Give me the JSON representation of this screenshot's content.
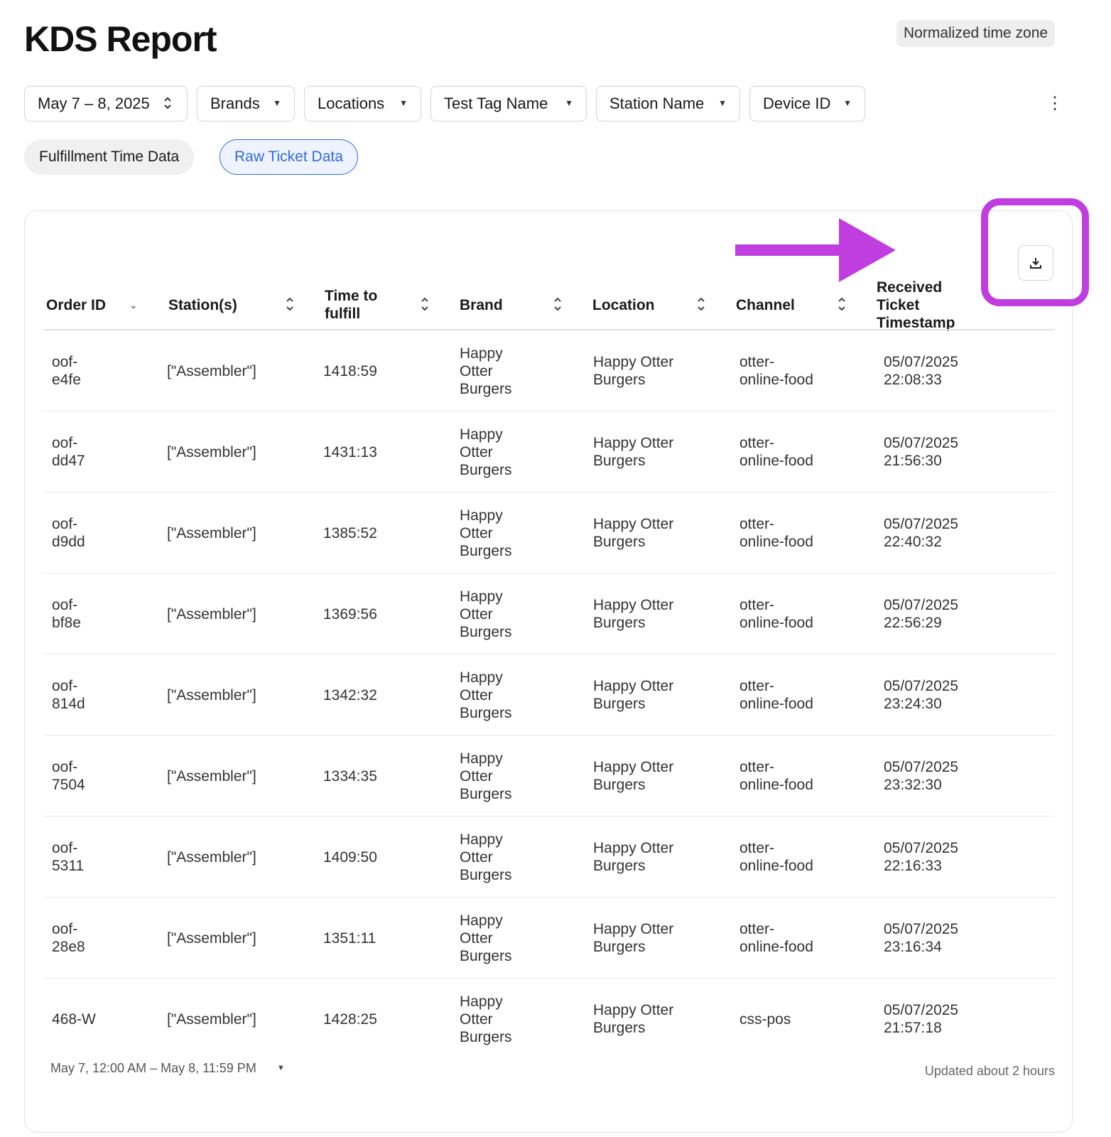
{
  "header": {
    "title": "KDS Report",
    "timezone_badge": "Normalized time zone"
  },
  "filters": {
    "date_range": "May 7 – 8, 2025",
    "brands": "Brands",
    "locations": "Locations",
    "test_tag": "Test Tag Name",
    "station": "Station Name",
    "device": "Device ID"
  },
  "tabs": {
    "fulfillment": "Fulfillment Time Data",
    "raw": "Raw Ticket Data"
  },
  "table": {
    "columns": {
      "order_id": "Order ID",
      "stations": "Station(s)",
      "time_to_fulfill_1": "Time to",
      "time_to_fulfill_2": "fulfill",
      "brand": "Brand",
      "location": "Location",
      "channel": "Channel",
      "received_1": "Received",
      "received_2": "Ticket",
      "received_3": "Timestamp"
    },
    "rows": [
      {
        "order_a": "oof-",
        "order_b": "e4fe",
        "station": "[\"Assembler\"]",
        "time": "1418:59",
        "brand_a": "Happy",
        "brand_b": "Otter",
        "brand_c": "Burgers",
        "loc_a": "Happy Otter",
        "loc_b": "Burgers",
        "chan_a": "otter-",
        "chan_b": "online-food",
        "date": "05/07/2025",
        "clock": "22:08:33"
      },
      {
        "order_a": "oof-",
        "order_b": "dd47",
        "station": "[\"Assembler\"]",
        "time": "1431:13",
        "brand_a": "Happy",
        "brand_b": "Otter",
        "brand_c": "Burgers",
        "loc_a": "Happy Otter",
        "loc_b": "Burgers",
        "chan_a": "otter-",
        "chan_b": "online-food",
        "date": "05/07/2025",
        "clock": "21:56:30"
      },
      {
        "order_a": "oof-",
        "order_b": "d9dd",
        "station": "[\"Assembler\"]",
        "time": "1385:52",
        "brand_a": "Happy",
        "brand_b": "Otter",
        "brand_c": "Burgers",
        "loc_a": "Happy Otter",
        "loc_b": "Burgers",
        "chan_a": "otter-",
        "chan_b": "online-food",
        "date": "05/07/2025",
        "clock": "22:40:32"
      },
      {
        "order_a": "oof-",
        "order_b": "bf8e",
        "station": "[\"Assembler\"]",
        "time": "1369:56",
        "brand_a": "Happy",
        "brand_b": "Otter",
        "brand_c": "Burgers",
        "loc_a": "Happy Otter",
        "loc_b": "Burgers",
        "chan_a": "otter-",
        "chan_b": "online-food",
        "date": "05/07/2025",
        "clock": "22:56:29"
      },
      {
        "order_a": "oof-",
        "order_b": "814d",
        "station": "[\"Assembler\"]",
        "time": "1342:32",
        "brand_a": "Happy",
        "brand_b": "Otter",
        "brand_c": "Burgers",
        "loc_a": "Happy Otter",
        "loc_b": "Burgers",
        "chan_a": "otter-",
        "chan_b": "online-food",
        "date": "05/07/2025",
        "clock": "23:24:30"
      },
      {
        "order_a": "oof-",
        "order_b": "7504",
        "station": "[\"Assembler\"]",
        "time": "1334:35",
        "brand_a": "Happy",
        "brand_b": "Otter",
        "brand_c": "Burgers",
        "loc_a": "Happy Otter",
        "loc_b": "Burgers",
        "chan_a": "otter-",
        "chan_b": "online-food",
        "date": "05/07/2025",
        "clock": "23:32:30"
      },
      {
        "order_a": "oof-",
        "order_b": "5311",
        "station": "[\"Assembler\"]",
        "time": "1409:50",
        "brand_a": "Happy",
        "brand_b": "Otter",
        "brand_c": "Burgers",
        "loc_a": "Happy Otter",
        "loc_b": "Burgers",
        "chan_a": "otter-",
        "chan_b": "online-food",
        "date": "05/07/2025",
        "clock": "22:16:33"
      },
      {
        "order_a": "oof-",
        "order_b": "28e8",
        "station": "[\"Assembler\"]",
        "time": "1351:11",
        "brand_a": "Happy",
        "brand_b": "Otter",
        "brand_c": "Burgers",
        "loc_a": "Happy Otter",
        "loc_b": "Burgers",
        "chan_a": "otter-",
        "chan_b": "online-food",
        "date": "05/07/2025",
        "clock": "23:16:34"
      },
      {
        "order_a": "468-W",
        "order_b": "",
        "station": "[\"Assembler\"]",
        "time": "1428:25",
        "brand_a": "Happy",
        "brand_b": "Otter",
        "brand_c": "Burgers",
        "loc_a": "Happy Otter",
        "loc_b": "Burgers",
        "chan_a": "css-pos",
        "chan_b": "",
        "date": "05/07/2025",
        "clock": "21:57:18"
      }
    ]
  },
  "footer": {
    "range": "May 7, 12:00 AM – May 8, 11:59 PM",
    "updated": "Updated about 2 hours"
  },
  "colors": {
    "highlight": "#c03ee0",
    "active_tab": "#2f6be0"
  },
  "icons": {
    "download": "download-icon",
    "kebab": "kebab-menu-icon",
    "caret": "caret-down-icon",
    "sort": "sort-updown-icon",
    "annotation_arrow": "arrow-right-icon"
  }
}
